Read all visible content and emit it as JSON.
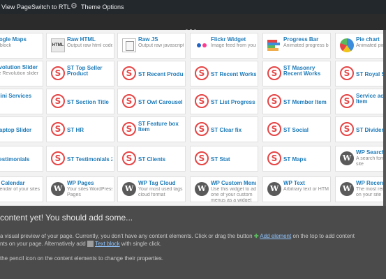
{
  "adminbar": {
    "view_page": "View Page",
    "switch_rtl": "Switch to RTL",
    "theme_options": "Theme Options",
    "gear_icon": "gear-icon"
  },
  "tiles": {
    "r1": [
      {
        "title": "oogle Maps",
        "desc": "p block",
        "icon": "maps-icon"
      },
      {
        "title": "Raw HTML",
        "desc": "Output raw html code on your page",
        "icon": "html-icon"
      },
      {
        "title": "Raw JS",
        "desc": "Output raw javascript code on your page",
        "icon": "js-icon"
      },
      {
        "title": "Flickr Widget",
        "desc": "Image feed from your flickr account",
        "icon": "flickr-icon"
      },
      {
        "title": "Progress Bar",
        "desc": "Animated progress bar",
        "icon": "progress-bar-icon"
      },
      {
        "title": "Pie chart",
        "desc": "Animated pie",
        "icon": "pie-chart-icon"
      }
    ],
    "r2": [
      {
        "title": "evolution Slider",
        "desc": "ce Revolution slider",
        "icon": ""
      },
      {
        "title": "ST Top Seller",
        "title2": "Product",
        "icon": "st-icon"
      },
      {
        "title": "ST Recent Product",
        "icon": "st-icon"
      },
      {
        "title": "ST Recent Works",
        "icon": "st-icon"
      },
      {
        "title": "ST Masonry",
        "title2": "Recent Works",
        "icon": "st-icon"
      },
      {
        "title": "ST Royal Sli",
        "icon": "st-icon"
      }
    ],
    "r3": [
      {
        "title": "Mini Services",
        "title2": "x",
        "icon": ""
      },
      {
        "title": "ST Section Title",
        "icon": "st-icon"
      },
      {
        "title": "ST Owl Carousel",
        "icon": "st-icon"
      },
      {
        "title": "ST List Progress",
        "icon": "st-icon"
      },
      {
        "title": "ST Member Item",
        "icon": "st-icon"
      },
      {
        "title": "Service acc",
        "title2": "Item",
        "icon": "st-icon"
      }
    ],
    "r4": [
      {
        "title": "Laptop Slider",
        "icon": ""
      },
      {
        "title": "ST HR",
        "icon": "st-icon"
      },
      {
        "title": "ST Feature box",
        "title2": "Item",
        "icon": "st-icon"
      },
      {
        "title": "ST Clear fix",
        "icon": "st-icon"
      },
      {
        "title": "ST Social",
        "icon": "st-icon"
      },
      {
        "title": "ST Divider",
        "icon": "st-icon"
      }
    ],
    "r5": [
      {
        "title": "Testimonials",
        "icon": ""
      },
      {
        "title": "ST Testimonials 2",
        "icon": "st-icon"
      },
      {
        "title": "ST Clients",
        "icon": "st-icon"
      },
      {
        "title": "ST Stat",
        "icon": "st-icon"
      },
      {
        "title": "ST Maps",
        "icon": "st-icon"
      },
      {
        "title": "WP Search",
        "desc": "A search form",
        "desc2": "site",
        "icon": "wp-icon"
      }
    ],
    "r6": [
      {
        "title": "P Calendar",
        "desc": "alendar of your sites",
        "desc2": "s",
        "icon": ""
      },
      {
        "title": "WP Pages",
        "desc": "Your sites WordPress",
        "desc2": "Pages",
        "icon": "wp-icon"
      },
      {
        "title": "WP Tag Cloud",
        "desc": "Your most used tags in",
        "desc2": "cloud format",
        "icon": "wp-icon"
      },
      {
        "title": "WP Custom Menu",
        "desc": "Use this widget to add",
        "desc2": "one of your custom",
        "desc3": "menus as a widget",
        "icon": "wp-icon"
      },
      {
        "title": "WP Text",
        "desc": "Arbitrary text or HTML",
        "icon": "wp-icon"
      },
      {
        "title": "WP Recent",
        "desc": "The most rece",
        "desc2": "on your site",
        "icon": "wp-icon"
      }
    ]
  },
  "empty_state": {
    "heading": "content yet! You should add some...",
    "line1_a": "a visual preview of your page. Currently, you don't have any content elements. Click or drag the button",
    "add_element": "Add element",
    "line1_b": "on the top to add content",
    "line2_a": "nts on your page. Alternatively add",
    "text_block": "Text block",
    "line2_b": "with single click.",
    "line3": "the pencil icon on the content elements to change their properties."
  }
}
